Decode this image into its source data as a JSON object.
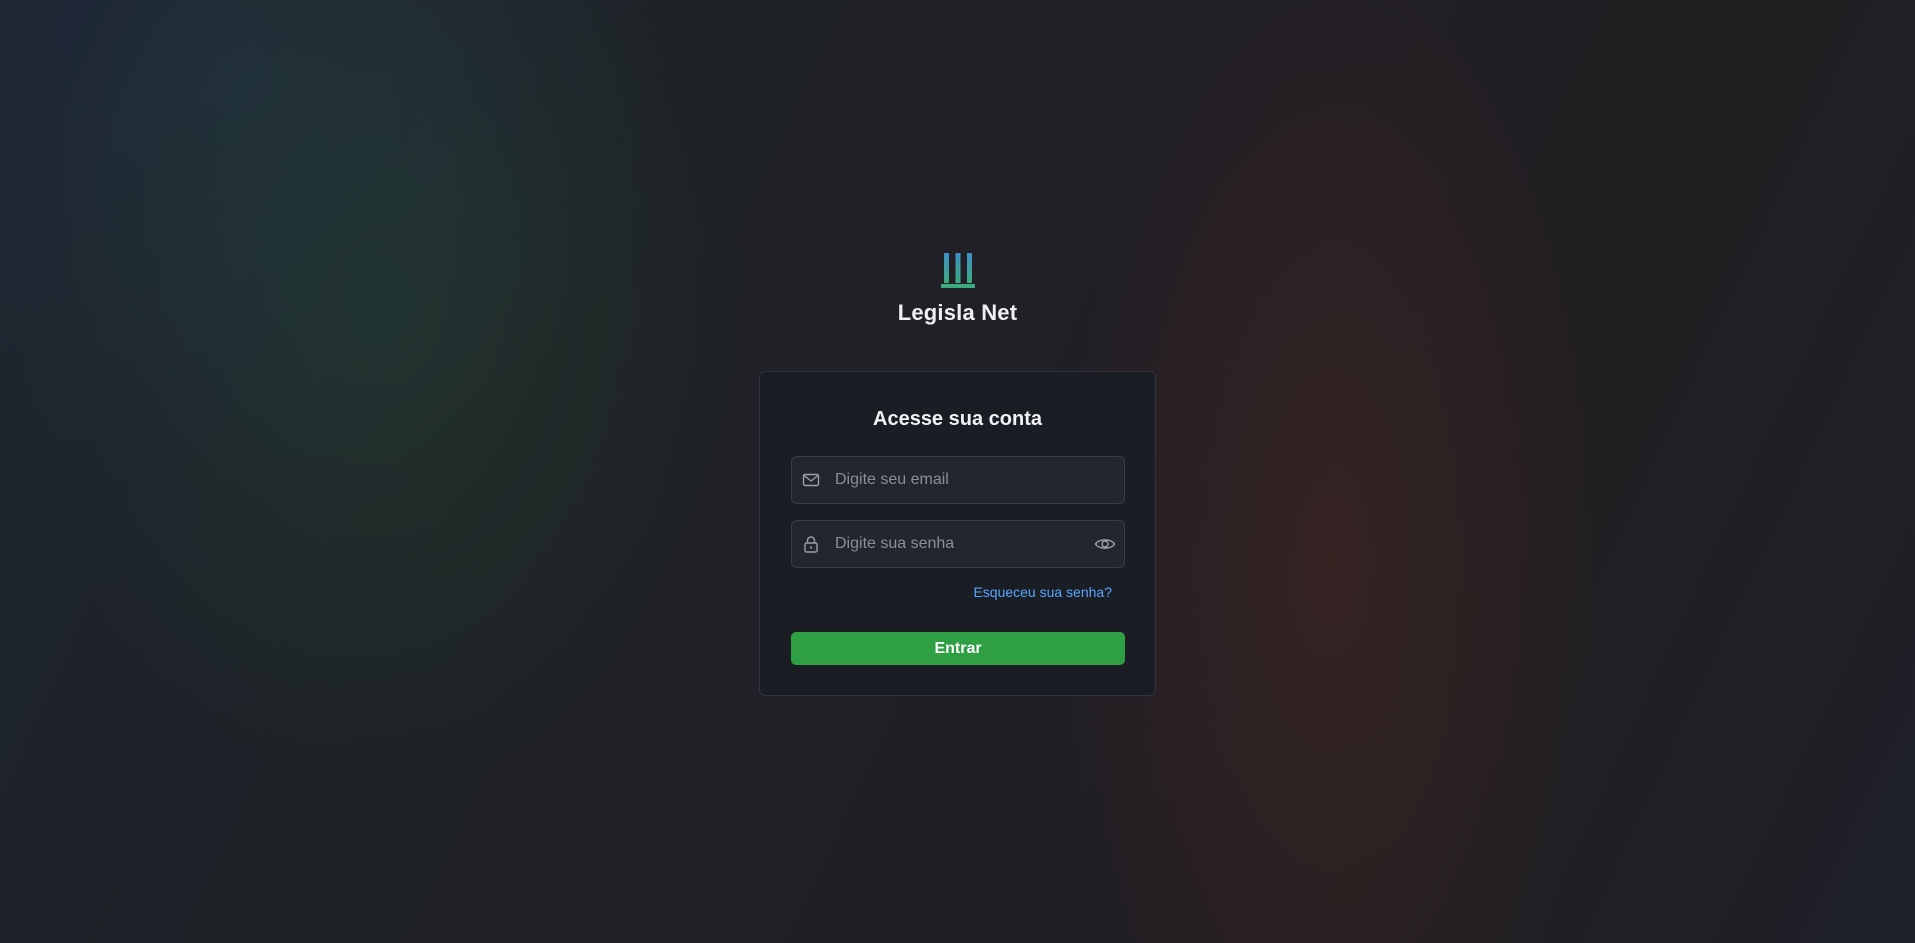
{
  "brand": {
    "name": "Legisla Net",
    "logo_icon": "columns-logo-icon"
  },
  "login": {
    "title": "Acesse sua conta",
    "email": {
      "value": "",
      "placeholder": "Digite seu email",
      "icon": "mail-icon"
    },
    "password": {
      "value": "",
      "placeholder": "Digite sua senha",
      "icon": "lock-icon",
      "toggle_icon": "eye-icon"
    },
    "forgot_label": "Esqueceu sua senha?",
    "submit_label": "Entrar"
  },
  "colors": {
    "accent_green": "#2ea043",
    "link_blue": "#58a6ff",
    "logo_teal": "#3ba38a",
    "logo_blue": "#3f8fc4"
  }
}
